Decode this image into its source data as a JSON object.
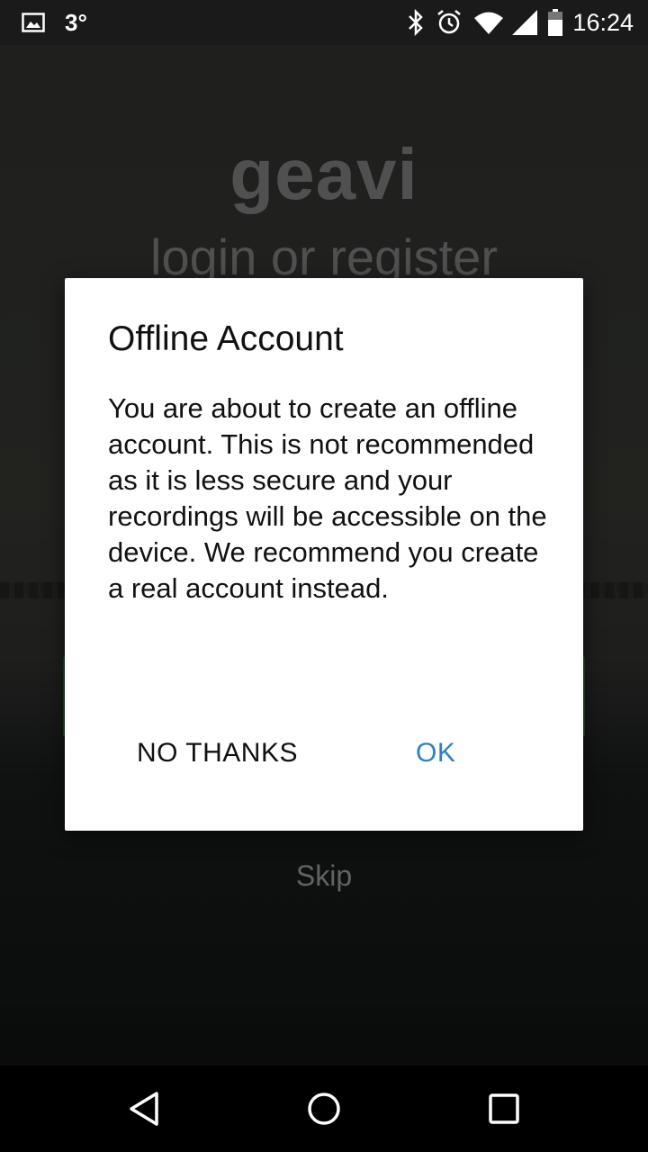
{
  "status_bar": {
    "temperature": "3°",
    "time": "16:24",
    "icons": [
      "image-notification-icon",
      "bluetooth-icon",
      "alarm-icon",
      "wifi-icon",
      "signal-icon",
      "battery-icon"
    ]
  },
  "app": {
    "logo": "geavi",
    "subtitle": "login or register",
    "skip_label": "Skip"
  },
  "dialog": {
    "title": "Offline Account",
    "message": "You are about to create an offline account. This is not recommended as it is less secure and your recordings will be accessible on the device. We recommend you create a real account instead.",
    "negative_label": "NO THANKS",
    "positive_label": "OK",
    "accent_color": "#2f7fc1"
  },
  "nav_bar": {
    "icons": [
      "back-icon",
      "home-icon",
      "recents-icon"
    ]
  }
}
